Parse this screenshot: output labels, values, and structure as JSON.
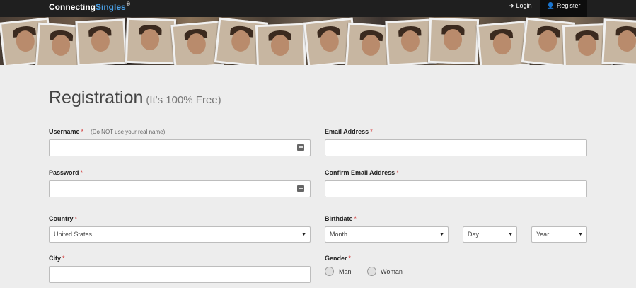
{
  "nav": {
    "brand_main": "Connecting",
    "brand_accent": "Singles",
    "brand_mark": "®",
    "login_label": "Login",
    "register_label": "Register",
    "login_icon": "sign-in-icon",
    "register_icon": "user-icon"
  },
  "page": {
    "title": "Registration",
    "subtitle": "(It's 100% Free)"
  },
  "form": {
    "username_label": "Username",
    "username_hint": "(Do NOT use your real name)",
    "username_value": "",
    "email_label": "Email Address",
    "email_value": "",
    "password_label": "Password",
    "password_value": "",
    "confirm_email_label": "Confirm Email Address",
    "confirm_email_value": "",
    "country_label": "Country",
    "country_value": "United States",
    "birthdate_label": "Birthdate",
    "month_value": "Month",
    "day_value": "Day",
    "year_value": "Year",
    "city_label": "City",
    "city_value": "",
    "gender_label": "Gender",
    "gender_options": [
      "Man",
      "Woman"
    ],
    "required_mark": "*"
  },
  "colors": {
    "topbar": "#1f1f1f",
    "brand_accent": "#4aa0e6",
    "required": "#d43b3b",
    "page_bg": "#ededed"
  }
}
